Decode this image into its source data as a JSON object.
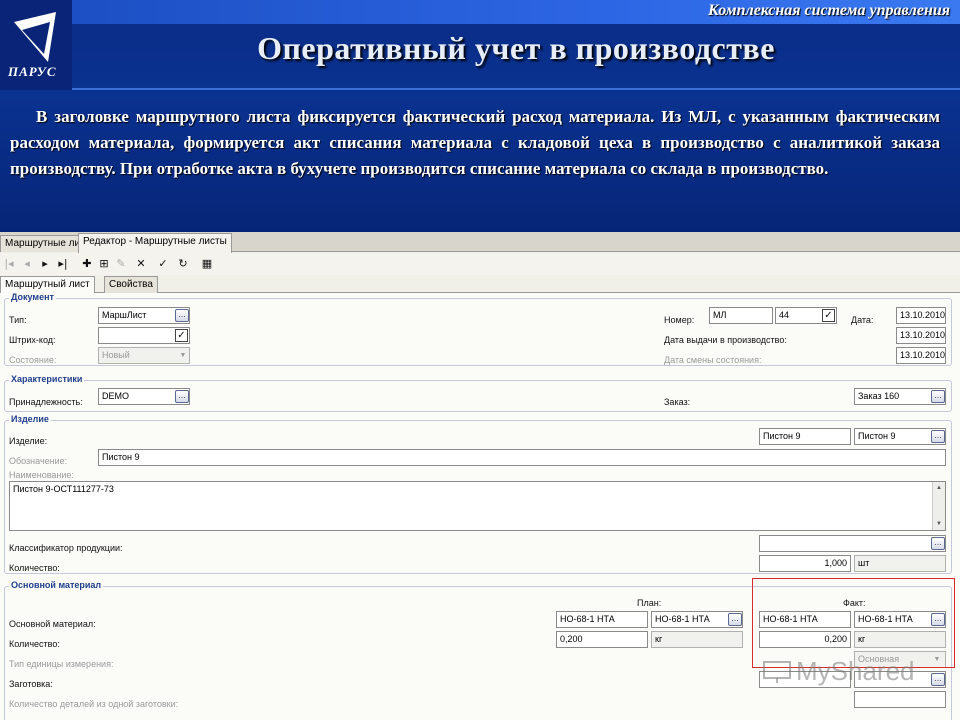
{
  "slide": {
    "logo_text": "ПАРУС",
    "header_banner": "Комплексная система управления",
    "title": "Оперативный учет в производстве",
    "paragraph": "В заголовке маршрутного листа фиксируется фактический расход материала. Из МЛ, с указанным фактическим расходом материала, формируется акт списания материала с кладовой цеха в производство с аналитикой заказа производству. При отработке акта в бухучете производится списание материала со склада в производство."
  },
  "app": {
    "tabs": [
      "Маршрутные листы",
      "Редактор - Маршрутные листы"
    ],
    "subtabs": [
      "Маршрутный лист",
      "Свойства"
    ],
    "toolbar_icons": [
      "first-icon",
      "prev-icon",
      "next-icon",
      "last-icon",
      "add-icon",
      "add-copy-icon",
      "edit-icon",
      "delete-icon",
      "apply-icon",
      "refresh-icon",
      "calendar-icon"
    ]
  },
  "document": {
    "section_title": "Документ",
    "type_label": "Тип:",
    "type_value": "МаршЛист",
    "barcode_label": "Штрих-код:",
    "barcode_value": "",
    "state_label": "Состояние:",
    "state_value": "Новый",
    "number_label": "Номер:",
    "number_prefix": "МЛ",
    "number_value": "44",
    "date_label": "Дата:",
    "date_value": "13.10.2010",
    "issue_date_label": "Дата выдачи в производство:",
    "issue_date_value": "13.10.2010",
    "state_change_label": "Дата смены состояния:",
    "state_change_value": "13.10.2010"
  },
  "characteristics": {
    "section_title": "Характеристики",
    "belonging_label": "Принадлежность:",
    "belonging_value": "DEMO",
    "order_label": "Заказ:",
    "order_value": "Заказ 160"
  },
  "product": {
    "section_title": "Изделие",
    "product_label": "Изделие:",
    "product_value_1": "Пистон 9",
    "product_value_2": "Пистон 9",
    "designation_label": "Обозначение:",
    "designation_value": "Пистон 9",
    "name_label": "Наименование:",
    "name_value": "Пистон 9-ОСТ111277-73",
    "classifier_label": "Классификатор продукции:",
    "classifier_value": "",
    "qty_label": "Количество:",
    "qty_value": "1,000",
    "qty_unit": "шт"
  },
  "material": {
    "section_title": "Основной материал",
    "plan_header": "План:",
    "fact_header": "Факт:",
    "main_material_label": "Основной материал:",
    "plan_material_1": "НО-68-1 НТА",
    "plan_material_2": "НО-68-1 НТА",
    "fact_material_1": "НО-68-1 НТА",
    "fact_material_2": "НО-68-1 НТА",
    "qty_label": "Количество:",
    "plan_qty": "0,200",
    "plan_unit": "кг",
    "fact_qty": "0,200",
    "fact_unit": "кг",
    "unit_type_label": "Тип единицы измерения:",
    "unit_type_value": "Основная",
    "blank_label": "Заготовка:",
    "details_per_blank_label": "Количество деталей из одной заготовки:"
  },
  "watermark": "MyShared",
  "colors": {
    "slide_bg": "#0a2c86",
    "banner": "#2d66e4",
    "section_title": "#1f3f8c",
    "highlight_border": "#d92b2b"
  }
}
